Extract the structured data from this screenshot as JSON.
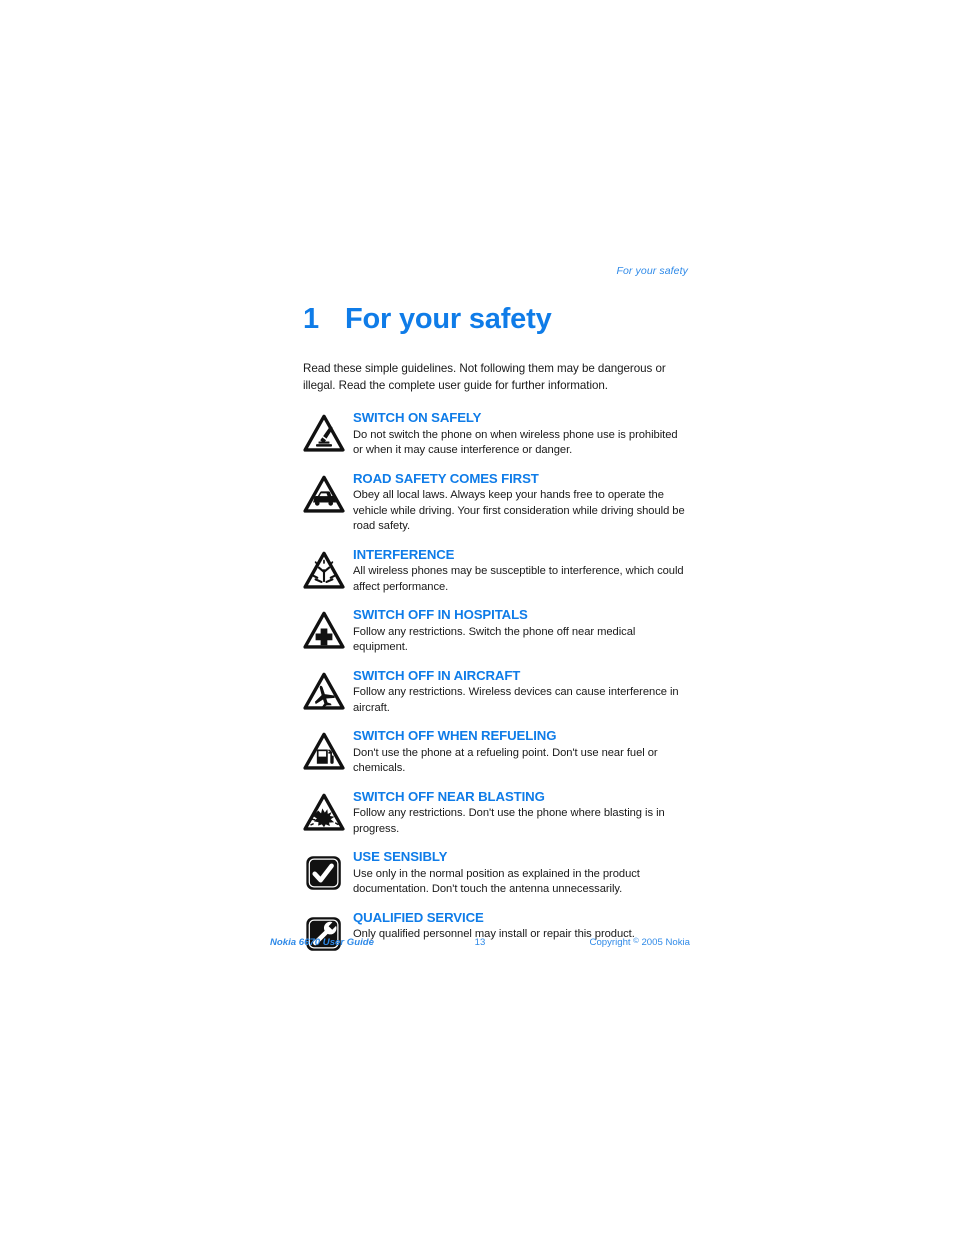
{
  "page": {
    "running_header": "For your safety",
    "chapter_number": "1",
    "chapter_title": "For your safety",
    "intro": "Read these simple guidelines. Not following them may be dangerous or illegal. Read the complete user guide for further information.",
    "accent_color": "#0f7ce8",
    "footer_color": "#2f8ae8"
  },
  "items": [
    {
      "icon": "triangle-hand-press-button-icon",
      "title": "SWITCH ON SAFELY",
      "body": "Do not switch the phone on when wireless phone use is prohibited or when it may cause interference or danger."
    },
    {
      "icon": "triangle-car-icon",
      "title": "ROAD SAFETY COMES FIRST",
      "body": "Obey all local laws. Always keep your hands free to operate the vehicle while driving. Your first consideration while driving should be road safety."
    },
    {
      "icon": "triangle-antenna-waves-icon",
      "title": "INTERFERENCE",
      "body": "All wireless phones may be susceptible to interference, which could affect performance."
    },
    {
      "icon": "triangle-medical-cross-icon",
      "title": "SWITCH OFF IN HOSPITALS",
      "body": "Follow any restrictions. Switch the phone off near medical equipment."
    },
    {
      "icon": "triangle-airplane-icon",
      "title": "SWITCH OFF IN AIRCRAFT",
      "body": "Follow any restrictions. Wireless devices can cause interference in aircraft."
    },
    {
      "icon": "triangle-fuel-pump-icon",
      "title": "SWITCH OFF WHEN REFUELING",
      "body": "Don't use the phone at a refueling point. Don't use near fuel or chemicals."
    },
    {
      "icon": "triangle-explosion-icon",
      "title": "SWITCH OFF NEAR BLASTING",
      "body": "Follow any restrictions. Don't use the phone where blasting is in progress."
    },
    {
      "icon": "rounded-square-checkmark-icon",
      "title": "USE SENSIBLY",
      "body": "Use only in the normal position as explained in the product documentation. Don't touch the antenna unnecessarily."
    },
    {
      "icon": "rounded-square-wrench-icon",
      "title": "QUALIFIED SERVICE",
      "body": "Only qualified personnel may install or repair this product."
    }
  ],
  "footer": {
    "left": "Nokia 6670 User Guide",
    "page_number": "13",
    "copyright_prefix": "Copyright",
    "copyright_symbol": "©",
    "copyright_suffix": "2005 Nokia"
  }
}
